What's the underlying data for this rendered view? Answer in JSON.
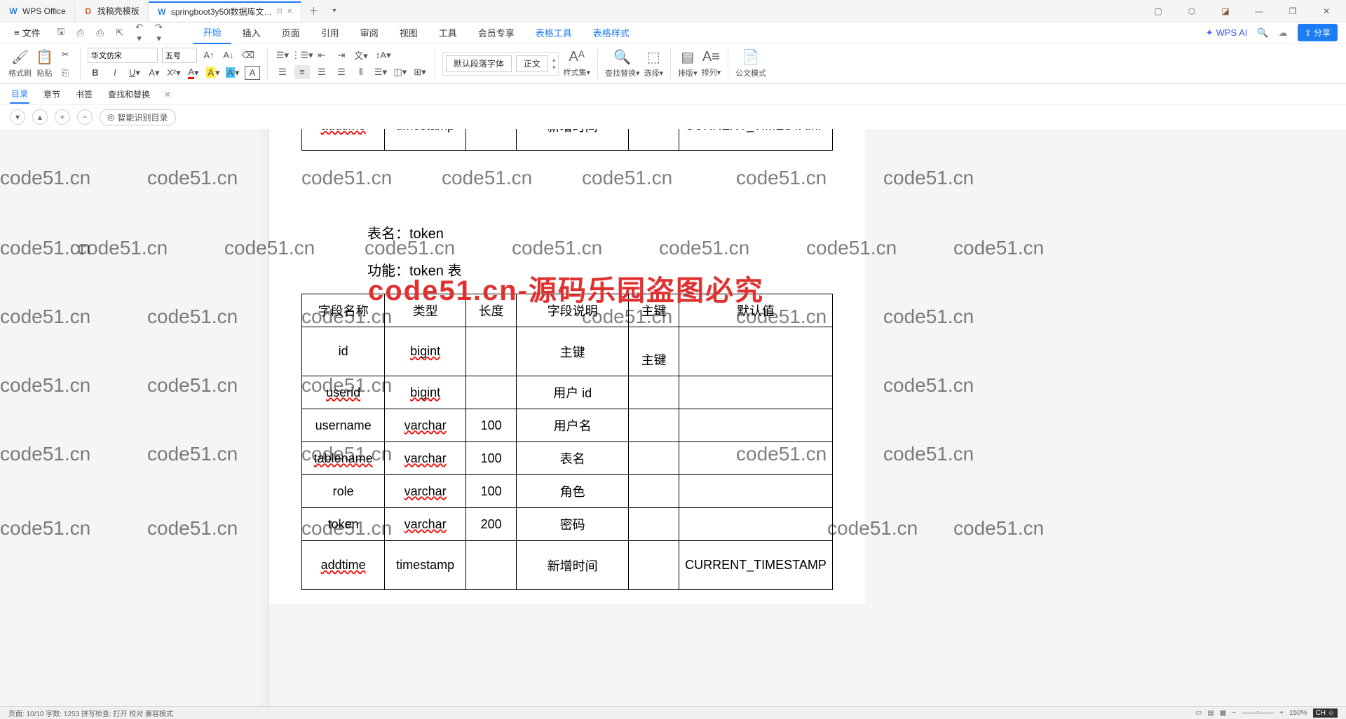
{
  "titlebar": {
    "tabs": [
      {
        "icon": "W",
        "label": "WPS Office",
        "active": false
      },
      {
        "icon": "D",
        "label": "找稿壳模板",
        "active": false
      },
      {
        "icon": "W",
        "label": "springboot3y50l数据库文…",
        "active": true
      }
    ]
  },
  "menu": {
    "file": "文件",
    "tabs": [
      "开始",
      "插入",
      "页面",
      "引用",
      "审阅",
      "视图",
      "工具",
      "会员专享"
    ],
    "toolTabs": [
      "表格工具",
      "表格样式"
    ],
    "ai": "WPS AI",
    "share": "分享"
  },
  "ribbon": {
    "formatBrush": "格式刷",
    "paste": "粘贴",
    "fontName": "华文仿宋",
    "fontSize": "五号",
    "defaultParagraphFont": "默认段落字体",
    "bodyText": "正文",
    "styleSet": "样式集",
    "findReplace": "查找替换",
    "select": "选择",
    "layoutOut": "排版",
    "arrange": "排列",
    "officialMode": "公文模式"
  },
  "secbar": {
    "items": [
      "目录",
      "章节",
      "书签",
      "查找和替换"
    ]
  },
  "ctrlbar": {
    "smartToc": "智能识别目录"
  },
  "document": {
    "topRow": [
      "addtime",
      "timestamp",
      "",
      "新增时间",
      "",
      "CURRENT_TIMESTAMP"
    ],
    "tableName": "表名：token",
    "tableFunc": "功能：token 表",
    "headers": [
      "字段名称",
      "类型",
      "长度",
      "字段说明",
      "主键",
      "默认值"
    ],
    "rows": [
      [
        "id",
        "bigint",
        "",
        "主键",
        "主键",
        ""
      ],
      [
        "userid",
        "bigint",
        "",
        "用户 id",
        "",
        ""
      ],
      [
        "username",
        "varchar",
        "100",
        "用户名",
        "",
        ""
      ],
      [
        "tablename",
        "varchar",
        "100",
        "表名",
        "",
        ""
      ],
      [
        "role",
        "varchar",
        "100",
        "角色",
        "",
        ""
      ],
      [
        "token",
        "varchar",
        "200",
        "密码",
        "",
        ""
      ],
      [
        "addtime",
        "timestamp",
        "",
        "新增时间",
        "",
        "CURRENT_TIMESTAMP"
      ]
    ]
  },
  "watermark": "code51.cn",
  "watermarkRed": "code51.cn-源码乐园盗图必究",
  "status": {
    "left": "页面: 10/10    字数: 1253    拼写检查: 打开    校对    兼容模式",
    "zoom": "150%"
  }
}
